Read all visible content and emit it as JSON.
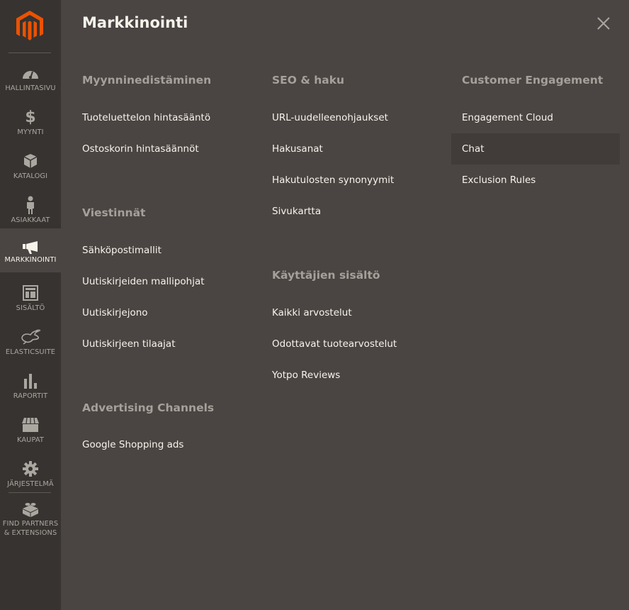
{
  "sidebar": {
    "logo": "magento-logo",
    "items": [
      {
        "label": "Hallintasivu",
        "icon": "dashboard-icon"
      },
      {
        "label": "Myynti",
        "icon": "dollar-icon"
      },
      {
        "label": "Katalogi",
        "icon": "box-icon"
      },
      {
        "label": "Asiakkaat",
        "icon": "person-icon"
      },
      {
        "label": "Markkinointi",
        "icon": "megaphone-icon",
        "active": true
      },
      {
        "label": "Sisältö",
        "icon": "layout-icon"
      },
      {
        "label": "ElasticSuite",
        "icon": "rabbit-icon"
      },
      {
        "label": "Raportit",
        "icon": "bar-chart-icon"
      },
      {
        "label": "Kaupat",
        "icon": "store-icon"
      },
      {
        "label": "Järjestelmä",
        "icon": "gear-icon"
      },
      {
        "label_line1": "Find Partners",
        "label_line2": "& Extensions",
        "icon": "lego-brick-icon"
      }
    ]
  },
  "panel": {
    "title": "Markkinointi",
    "close_icon": "close-icon",
    "columns": [
      {
        "sections": [
          {
            "title": "Myynninedistäminen",
            "links": [
              "Tuoteluettelon hintasääntö",
              "Ostoskorin hintasäännöt"
            ]
          },
          {
            "title": "Viestinnät",
            "links": [
              "Sähköpostimallit",
              "Uutiskirjeiden mallipohjat",
              "Uutiskirjejono",
              "Uutiskirjeen tilaajat"
            ]
          },
          {
            "title": "Advertising Channels",
            "links": [
              "Google Shopping ads"
            ]
          }
        ]
      },
      {
        "sections": [
          {
            "title": "SEO & haku",
            "links": [
              "URL-uudelleenohjaukset",
              "Hakusanat",
              "Hakutulosten synonyymit",
              "Sivukartta"
            ]
          },
          {
            "title": "Käyttäjien sisältö",
            "links": [
              "Kaikki arvostelut",
              "Odottavat tuotearvostelut",
              "Yotpo Reviews"
            ]
          }
        ]
      },
      {
        "sections": [
          {
            "title": "Customer Engagement",
            "links": [
              "Engagement Cloud",
              "Chat",
              "Exclusion Rules"
            ],
            "highlighted": "Chat"
          }
        ]
      }
    ]
  },
  "colors": {
    "sidebar_bg": "#373330",
    "panel_bg": "#4a4542",
    "brand_orange": "#eb5202",
    "text": "#f7f3eb",
    "section_title": "#a6a09a"
  }
}
